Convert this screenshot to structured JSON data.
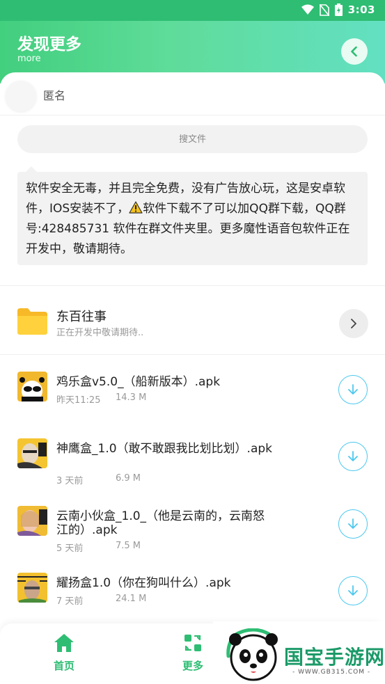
{
  "status_bar": {
    "time": "3:03"
  },
  "header": {
    "title": "发现更多",
    "subtitle": "more"
  },
  "user": {
    "name": "匿名"
  },
  "search": {
    "placeholder": "搜文件"
  },
  "notice": {
    "text_before_icon": "软件安全无毒，并且完全免费，没有广告放心玩，这是安卓软件，IOS安装不了，",
    "text_after_icon": "软件下载不了可以加QQ群下载，QQ群号:428485731 软件在群文件夹里。更多魔性语音包软件正在开发中，敬请期待。",
    "icon": "warning-icon"
  },
  "folder": {
    "name": "东百往事",
    "desc": "正在开发中敬请期待.."
  },
  "files": [
    {
      "name": "鸡乐盒v5.0_（船新版本）.apk",
      "time": "昨天11:25",
      "size": "14.3 M"
    },
    {
      "name": "神鹰盒_1.0（敢不敢跟我比划比划）.apk",
      "time": "3 天前",
      "size": "6.9 M"
    },
    {
      "name": "云南小伙盒_1.0_（他是云南的，云南怒江的）.apk",
      "time": "5 天前",
      "size": "7.5 M"
    },
    {
      "name": "耀扬盒1.0（你在狗叫什么）.apk",
      "time": "7 天前",
      "size": "24.1 M"
    }
  ],
  "nav": {
    "home": "首页",
    "more": "更多"
  },
  "watermark": {
    "text": "国宝手游网",
    "url": "- WWW.GB315.COM -"
  },
  "colors": {
    "accent": "#2ebd73",
    "download": "#4cc8ee"
  }
}
